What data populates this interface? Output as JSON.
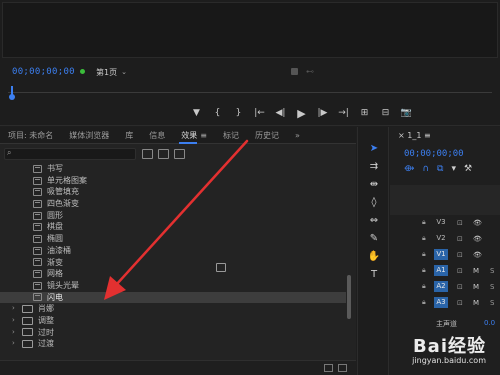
{
  "monitor": {
    "timecode": "00;00;00;00",
    "page_select": "第1页",
    "transport": [
      "▼",
      "{",
      "}",
      "|←",
      "◀|",
      "▶",
      "|▶",
      "→|",
      "⊞",
      "⊟",
      "📷"
    ]
  },
  "effects_panel": {
    "tabs": [
      {
        "label": "项目: 未命名",
        "active": false
      },
      {
        "label": "媒体浏览器",
        "active": false
      },
      {
        "label": "库",
        "active": false
      },
      {
        "label": "信息",
        "active": false
      },
      {
        "label": "效果",
        "active": true,
        "menu": "≡"
      },
      {
        "label": "标记",
        "active": false
      },
      {
        "label": "历史记",
        "active": false
      }
    ],
    "overflow": "»",
    "search_placeholder": "",
    "items": [
      {
        "label": "书写",
        "type": "effect"
      },
      {
        "label": "单元格图案",
        "type": "effect"
      },
      {
        "label": "吸管填充",
        "type": "effect"
      },
      {
        "label": "四色渐变",
        "type": "effect"
      },
      {
        "label": "圆形",
        "type": "effect"
      },
      {
        "label": "棋盘",
        "type": "effect"
      },
      {
        "label": "椭圆",
        "type": "effect"
      },
      {
        "label": "油漆桶",
        "type": "effect"
      },
      {
        "label": "渐变",
        "type": "effect"
      },
      {
        "label": "网格",
        "type": "effect"
      },
      {
        "label": "镜头光晕",
        "type": "effect"
      },
      {
        "label": "闪电",
        "type": "effect",
        "selected": true
      },
      {
        "label": "肖娜",
        "type": "folder"
      },
      {
        "label": "调整",
        "type": "folder"
      },
      {
        "label": "过时",
        "type": "folder"
      },
      {
        "label": "过渡",
        "type": "folder"
      }
    ]
  },
  "timeline": {
    "sequence_name": "1_1",
    "timecode": "00;00;00;00",
    "tracks": [
      {
        "name": "V3",
        "on": false,
        "kind": "video"
      },
      {
        "name": "V2",
        "on": false,
        "kind": "video"
      },
      {
        "name": "V1",
        "on": true,
        "kind": "video"
      },
      {
        "name": "A1",
        "on": true,
        "kind": "audio"
      },
      {
        "name": "A2",
        "on": true,
        "kind": "audio"
      },
      {
        "name": "A3",
        "on": true,
        "kind": "audio"
      }
    ],
    "master_label": "主声道",
    "master_value": "0.0"
  },
  "watermark": {
    "logo": "Bai经验",
    "url": "jingyan.baidu.com"
  },
  "colors": {
    "accent_blue": "#3c7ff0",
    "arrow_red": "#e33030",
    "track_on": "#2a64a8"
  }
}
